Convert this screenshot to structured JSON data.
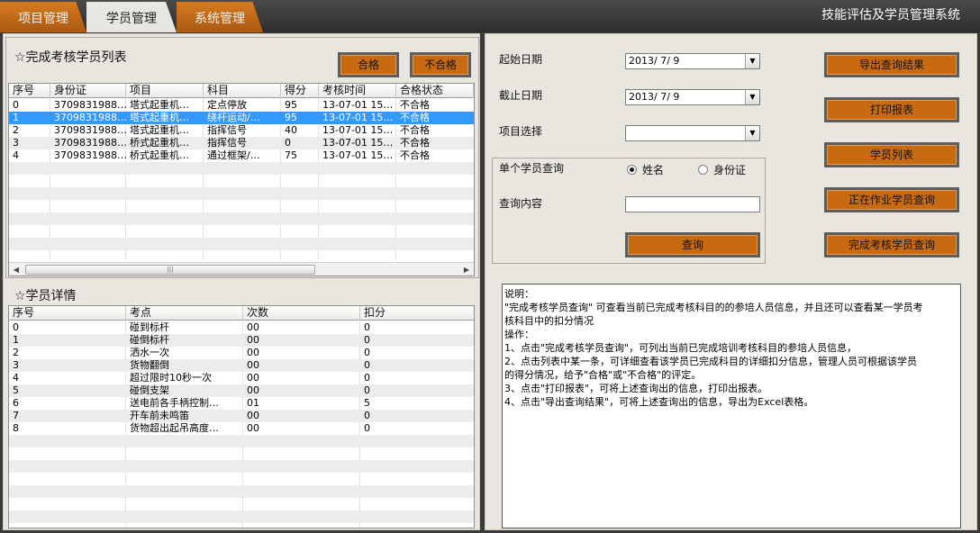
{
  "app": {
    "title": "技能评估及学员管理系统",
    "tabs": [
      {
        "label": "项目管理",
        "active": false
      },
      {
        "label": "学员管理",
        "active": true
      },
      {
        "label": "系统管理",
        "active": false
      }
    ]
  },
  "completed_list": {
    "title": "☆完成考核学员列表",
    "pass_button": "合格",
    "fail_button": "不合格",
    "columns": [
      "序号",
      "身份证",
      "项目",
      "科目",
      "得分",
      "考核时间",
      "合格状态"
    ],
    "rows": [
      [
        "0",
        "3709831988…",
        "塔式起重机…",
        "定点停放",
        "95",
        "13-07-01 15…",
        "不合格"
      ],
      [
        "1",
        "3709831988…",
        "塔式起重机…",
        "绕杆运动/…",
        "95",
        "13-07-01 15…",
        "不合格"
      ],
      [
        "2",
        "3709831988…",
        "塔式起重机…",
        "指挥信号",
        "40",
        "13-07-01 15…",
        "不合格"
      ],
      [
        "3",
        "3709831988…",
        "桥式起重机…",
        "指挥信号",
        "0",
        "13-07-01 15…",
        "不合格"
      ],
      [
        "4",
        "3709831988…",
        "桥式起重机…",
        "通过框架/…",
        "75",
        "13-07-01 15…",
        "不合格"
      ]
    ],
    "selected_index": 1
  },
  "student_detail": {
    "title": "☆学员详情",
    "columns": [
      "序号",
      "考点",
      "次数",
      "扣分"
    ],
    "rows": [
      [
        "0",
        "碰到标杆",
        "00",
        "0"
      ],
      [
        "1",
        "碰倒标杆",
        "00",
        "0"
      ],
      [
        "2",
        "洒水一次",
        "00",
        "0"
      ],
      [
        "3",
        "货物翻倒",
        "00",
        "0"
      ],
      [
        "4",
        "超过限时10秒一次",
        "00",
        "0"
      ],
      [
        "5",
        "碰倒支架",
        "00",
        "0"
      ],
      [
        "6",
        "送电前各手柄控制…",
        "01",
        "5"
      ],
      [
        "7",
        "开车前未鸣笛",
        "00",
        "0"
      ],
      [
        "8",
        "货物超出起吊高度…",
        "00",
        "0"
      ]
    ]
  },
  "query": {
    "start_date_label": "起始日期",
    "start_date_value": "2013/ 7/ 9",
    "end_date_label": "截止日期",
    "end_date_value": "2013/ 7/ 9",
    "project_label": "项目选择",
    "project_value": "",
    "single_query_label": "单个学员查询",
    "radio_name": "姓名",
    "radio_id": "身份证",
    "content_label": "查询内容",
    "content_value": "",
    "search_button": "查询"
  },
  "actions": {
    "export": "导出查询结果",
    "print": "打印报表",
    "student_list": "学员列表",
    "working_query": "正在作业学员查询",
    "completed_query": "完成考核学员查询"
  },
  "notes": {
    "lines": [
      "说明：",
      "\"完成考核学员查询\" 可查看当前已完成考核科目的的参培人员信息，并且还可以查看某一学员考",
      "核科目中的扣分情况",
      "操作：",
      "1、点击\"完成考核学员查询\"，可列出当前已完成培训考核科目的参培人员信息，",
      "2、点击列表中某一条，可详细查看该学员已完成科目的详细扣分信息，管理人员可根据该学员",
      "的得分情况，给予\"合格\"或\"不合格\"的评定。",
      "3、点击\"打印报表\"，可将上述查询出的信息，打印出报表。",
      "4、点击\"导出查询结果\"，可将上述查询出的信息，导出为Excel表格。"
    ]
  }
}
